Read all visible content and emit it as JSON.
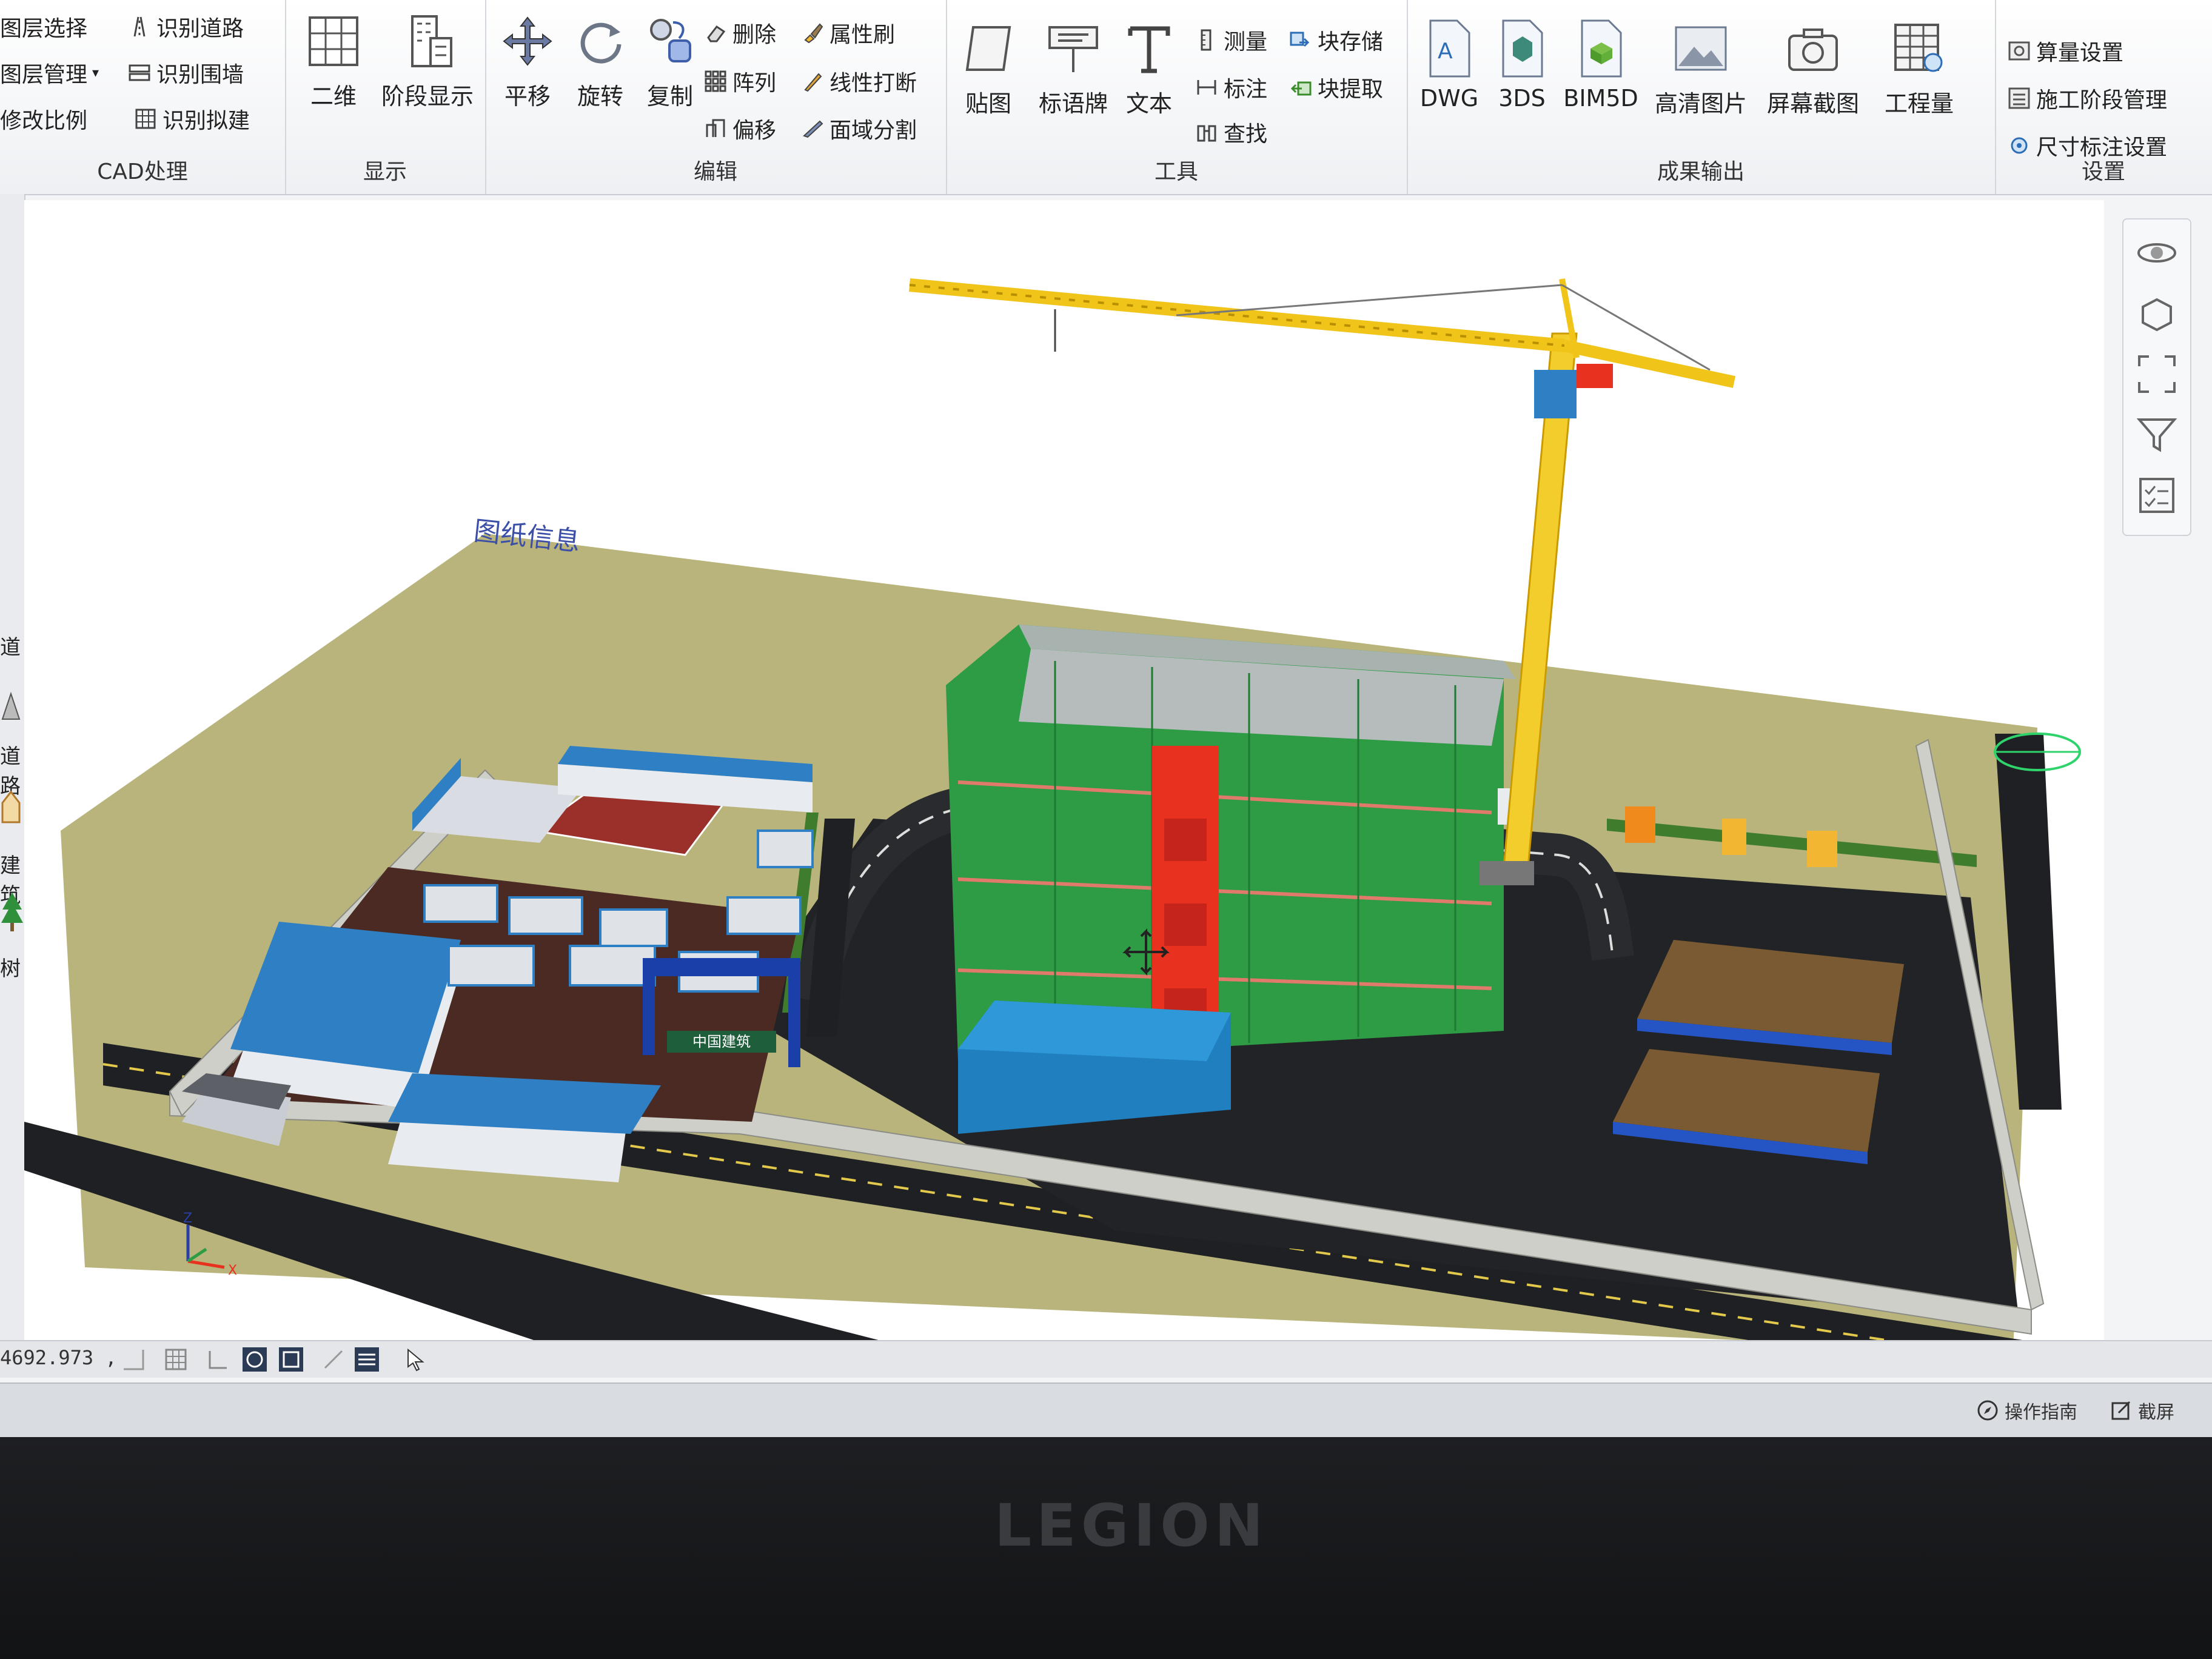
{
  "ribbon": {
    "cad": {
      "label": "CAD处理",
      "items": [
        "图层选择",
        "识别道路",
        "图层管理",
        "识别围墙",
        "修改比例",
        "识别拟建"
      ]
    },
    "display": {
      "label": "显示",
      "items": [
        "二维",
        "阶段显示"
      ]
    },
    "edit": {
      "label": "编辑",
      "big": [
        "平移",
        "旋转",
        "复制"
      ],
      "small": [
        "删除",
        "属性刷",
        "阵列",
        "线性打断",
        "偏移",
        "面域分割"
      ]
    },
    "tools": {
      "label": "工具",
      "big": [
        "贴图",
        "标语牌",
        "文本"
      ],
      "small": [
        "测量",
        "块存储",
        "标注",
        "块提取",
        "查找"
      ]
    },
    "output": {
      "label": "成果输出",
      "items": [
        "DWG",
        "3DS",
        "BIM5D",
        "高清图片",
        "屏幕截图",
        "工程量"
      ]
    },
    "settings": {
      "label": "设置",
      "items": [
        "算量设置",
        "施工阶段管理",
        "尺寸标注设置"
      ]
    }
  },
  "leftbar": {
    "items": [
      "道",
      "道路",
      "建筑",
      "树"
    ]
  },
  "viewport": {
    "drawing_label": "图纸信息",
    "gate_sign": "中国建筑"
  },
  "statusbar": {
    "coordinate": "4692.973 ,"
  },
  "bottombar": {
    "guide": "操作指南",
    "screenshot": "截屏"
  },
  "bezel": {
    "brand": "LEGION"
  },
  "colors": {
    "crane": "#f0c419",
    "building": "#2e9b45",
    "hoist": "#e8311f",
    "roof_blue": "#2f7fc4",
    "ground": "#b8b37a",
    "road": "#1e1f22"
  }
}
